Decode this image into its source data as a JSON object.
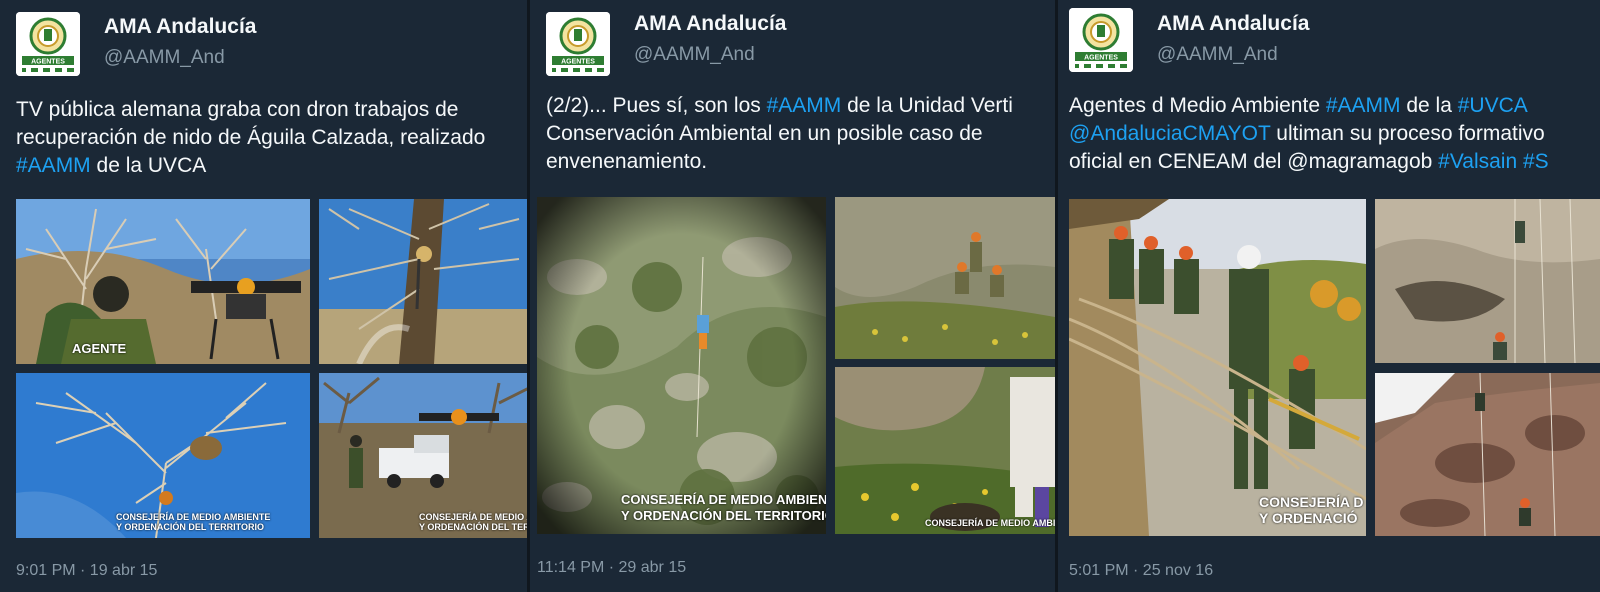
{
  "tweets": [
    {
      "name": "AMA Andalucía",
      "handle": "@AAMM_And",
      "avatar_label": "AGENTES",
      "text_lines": [
        [
          {
            "t": "TV pública alemana graba con dron trabajos de",
            "tag": false
          }
        ],
        [
          {
            "t": "recuperación de nido de Águila Calzada, realizado",
            "tag": false
          }
        ],
        [
          {
            "t": "#AAMM",
            "tag": true
          },
          {
            "t": " de la UVCA",
            "tag": false
          }
        ]
      ],
      "photos": [
        {
          "desc": "agent-watching-drone",
          "badge": "AGENTE",
          "caption": ""
        },
        {
          "desc": "climber-in-tree",
          "caption": ""
        },
        {
          "desc": "nest-in-tree",
          "caption": "CONSEJERÍA DE MEDIO AMBIENTE\nY ORDENACIÓN DEL TERRITORIO"
        },
        {
          "desc": "drone-and-truck",
          "caption": "CONSEJERÍA DE MEDIO AMBIENTE\nY ORDENACIÓN DEL TERRITORIO"
        }
      ],
      "timestamp": "9:01 PM · 19 abr 15"
    },
    {
      "name": "AMA Andalucía",
      "handle": "@AAMM_And",
      "avatar_label": "AGENTES",
      "text_lines": [
        [
          {
            "t": "(2/2)... Pues sí, son los ",
            "tag": false
          },
          {
            "t": "#AAMM",
            "tag": true
          },
          {
            "t": " de la Unidad Verti",
            "tag": false
          }
        ],
        [
          {
            "t": "Conservación Ambiental en un posible caso de",
            "tag": false
          }
        ],
        [
          {
            "t": "envenenamiento.",
            "tag": false
          }
        ]
      ],
      "photos": [
        {
          "desc": "rappelling-cliff",
          "caption": "CONSEJERÍA DE MEDIO AMBIENTE\nY ORDENACIÓN DEL TERRITORIO"
        },
        {
          "desc": "team-on-slope",
          "caption": ""
        },
        {
          "desc": "agent-at-rocks",
          "caption": "CONSEJERÍA DE MEDIO AMBIENTE"
        }
      ],
      "timestamp": "11:14 PM · 29 abr 15"
    },
    {
      "name": "AMA Andalucía",
      "handle": "@AAMM_And",
      "avatar_label": "AGENTES",
      "text_lines": [
        [
          {
            "t": "Agentes d Medio Ambiente ",
            "tag": false
          },
          {
            "t": "#AAMM",
            "tag": true
          },
          {
            "t": " de la ",
            "tag": false
          },
          {
            "t": "#UVCA",
            "tag": true
          }
        ],
        [
          {
            "t": "@AndaluciaCMAYOT",
            "tag": true
          },
          {
            "t": " ultiman su proceso formativo",
            "tag": false
          }
        ],
        [
          {
            "t": "oficial en CENEAM del @magramagob ",
            "tag": false
          },
          {
            "t": "#Valsain",
            "tag": true
          },
          {
            "t": " #S",
            "tag": true
          }
        ]
      ],
      "photos": [
        {
          "desc": "agents-roped-on-cliff",
          "caption": "CONSEJERÍA D\nY ORDENACIÓ"
        },
        {
          "desc": "cliff-climbers",
          "caption": ""
        },
        {
          "desc": "red-rock-climbers",
          "caption": ""
        }
      ],
      "timestamp": "5:01 PM · 25 nov 16"
    }
  ],
  "colors": {
    "background": "#1b2836",
    "link": "#1da1f2",
    "muted": "#8899a6",
    "text": "#f5f8fa"
  }
}
